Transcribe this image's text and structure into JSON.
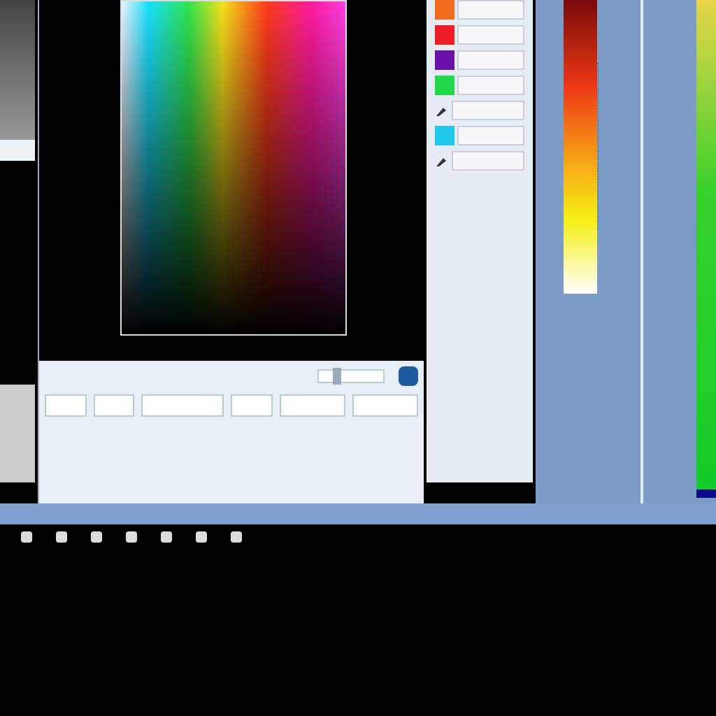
{
  "swatches": [
    {
      "kind": "swatch",
      "color": "#f26a1b"
    },
    {
      "kind": "swatch",
      "color": "#ee1c25"
    },
    {
      "kind": "swatch",
      "color": "#6a12a8"
    },
    {
      "kind": "swatch",
      "color": "#22d84a"
    },
    {
      "kind": "tool"
    },
    {
      "kind": "swatch",
      "color": "#1fc8ec"
    },
    {
      "kind": "tool"
    }
  ],
  "slider": {
    "level": 0.25
  },
  "toolbar_groups": [
    {
      "kind": "pair"
    },
    {
      "kind": "pair"
    },
    {
      "kind": "triple"
    },
    {
      "kind": "pair"
    },
    {
      "kind": "field"
    },
    {
      "kind": "field"
    }
  ],
  "taskbar_icons": [
    {
      "kind": "icon"
    },
    {
      "kind": "icon"
    },
    {
      "kind": "icon"
    },
    {
      "kind": "icon"
    },
    {
      "kind": "icon"
    },
    {
      "kind": "icon"
    },
    {
      "kind": "icon"
    }
  ]
}
